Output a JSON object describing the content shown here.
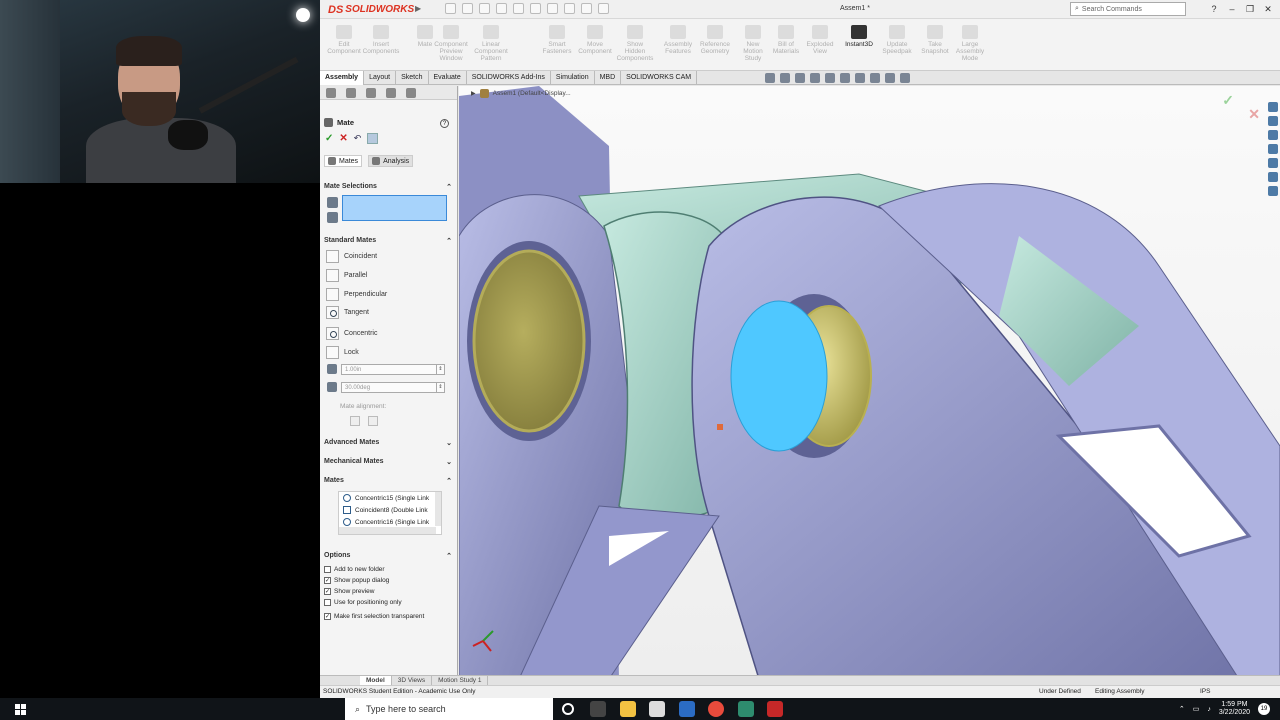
{
  "app": {
    "logo_ds": "DS",
    "logo_name": "SOLIDWORKS",
    "doc_title": "Assem1 *",
    "search_placeholder": "Search Commands"
  },
  "commands": [
    {
      "label": "Edit\nComponent"
    },
    {
      "label": "Insert\nComponents"
    },
    {
      "label": "Mate"
    },
    {
      "label": "Component\nPreview\nWindow"
    },
    {
      "label": "Linear Component\nPattern"
    },
    {
      "label": "Smart\nFasteners"
    },
    {
      "label": "Move\nComponent"
    },
    {
      "label": "Show\nHidden\nComponents"
    },
    {
      "label": "Assembly\nFeatures"
    },
    {
      "label": "Reference\nGeometry"
    },
    {
      "label": "New\nMotion\nStudy"
    },
    {
      "label": "Bill of\nMaterials"
    },
    {
      "label": "Exploded\nView"
    },
    {
      "label": "Instant3D"
    },
    {
      "label": "Update\nSpeedpak"
    },
    {
      "label": "Take\nSnapshot"
    },
    {
      "label": "Large\nAssembly\nMode"
    }
  ],
  "tabs": [
    "Assembly",
    "Layout",
    "Sketch",
    "Evaluate",
    "SOLIDWORKS Add-Ins",
    "Simulation",
    "MBD",
    "SOLIDWORKS CAM"
  ],
  "tree_crumb": "Assem1  (Default<Display...",
  "property_manager": {
    "title": "Mate",
    "subtabs": [
      "Mates",
      "Analysis"
    ],
    "group_mate_selections": "Mate Selections",
    "group_standard_mates": "Standard Mates",
    "standard_mates": [
      "Coincident",
      "Parallel",
      "Perpendicular",
      "Tangent",
      "Concentric",
      "Lock"
    ],
    "distance_value": "1.00in",
    "angle_value": "30.00deg",
    "mate_alignment": "Mate alignment:",
    "group_advanced": "Advanced Mates",
    "group_mechanical": "Mechanical Mates",
    "group_mates": "Mates",
    "mates_list": [
      "Concentric15 (Single Link",
      "Coincident8 (Double Link",
      "Concentric16 (Single Link"
    ],
    "group_options": "Options",
    "options": [
      {
        "label": "Add to new folder",
        "checked": false
      },
      {
        "label": "Show popup dialog",
        "checked": true
      },
      {
        "label": "Show preview",
        "checked": true
      },
      {
        "label": "Use for positioning only",
        "checked": false
      },
      {
        "label": "Make first selection transparent",
        "checked": true
      }
    ]
  },
  "bottom_tabs": [
    "Model",
    "3D Views",
    "Motion Study 1"
  ],
  "status": {
    "edition": "SOLIDWORKS Student Edition - Academic Use Only",
    "definition": "Under Defined",
    "mode": "Editing Assembly",
    "units": "IPS"
  },
  "taskbar": {
    "search_placeholder": "Type here to search",
    "time": "1:59 PM",
    "date": "3/22/2020",
    "badge": "19"
  },
  "colors": {
    "link_purple": "#8a8fc2",
    "link_teal": "#9fcfc4",
    "pin_gold": "#cfc66a",
    "selected_face": "#4fc8ff"
  }
}
